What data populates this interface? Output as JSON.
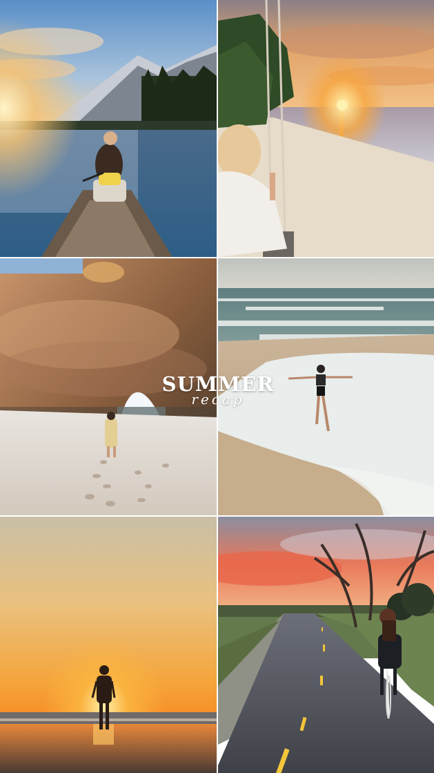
{
  "collage": {
    "overlay_title": "SUMMER",
    "overlay_subtitle": "recap",
    "tiles": [
      {
        "scene": "canoe-lake-sunset"
      },
      {
        "scene": "beach-swing-sunset"
      },
      {
        "scene": "sea-cave-beach"
      },
      {
        "scene": "surf-beach-run"
      },
      {
        "scene": "sunset-beach-walk"
      },
      {
        "scene": "bike-path-sunset"
      }
    ]
  },
  "colors": {
    "text": "#ffffff",
    "sunset_orange": "#f59a3a",
    "sky_blue": "#6aa0d0",
    "sand": "#e8dccb"
  }
}
